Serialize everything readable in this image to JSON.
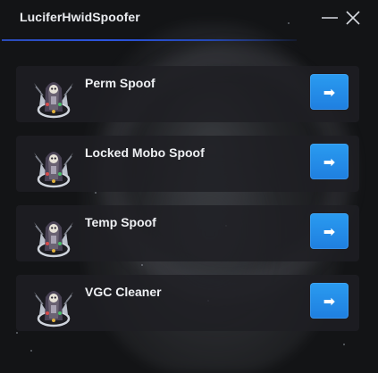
{
  "window": {
    "title": "LuciferHwidSpoofer",
    "accent_color": "#2c55e0",
    "controls": [
      "minimize-icon",
      "close-icon"
    ]
  },
  "items": [
    {
      "label": "Perm Spoof",
      "icon": "reaper-emblem-icon",
      "action_icon": "arrow-right-icon",
      "action_glyph": "➡"
    },
    {
      "label": "Locked Mobo Spoof",
      "icon": "reaper-emblem-icon",
      "action_icon": "arrow-right-icon",
      "action_glyph": "➡"
    },
    {
      "label": "Temp Spoof",
      "icon": "reaper-emblem-icon",
      "action_icon": "arrow-right-icon",
      "action_glyph": "➡"
    },
    {
      "label": "VGC Cleaner",
      "icon": "reaper-emblem-icon",
      "action_icon": "arrow-right-icon",
      "action_glyph": "➡"
    }
  ],
  "colors": {
    "background": "#131416",
    "card": "#1e1f23",
    "button": "#2391ea",
    "text": "#eef0f3"
  }
}
